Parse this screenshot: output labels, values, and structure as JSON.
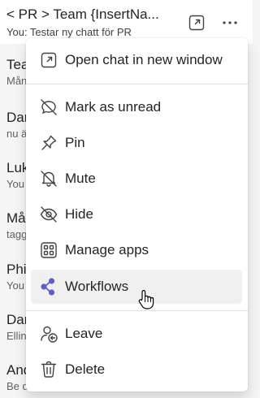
{
  "chat": {
    "title": "< PR > Team {InsertNa...",
    "subtitle": "You: Testar ny chatt för PR",
    "rows": [
      {
        "name": "Tea",
        "preview": "Mån"
      },
      {
        "name": "Dar",
        "preview": "nu ä"
      },
      {
        "name": "Luk",
        "preview": "You"
      },
      {
        "name": "Må",
        "preview": "tagg"
      },
      {
        "name": "Phi",
        "preview": "You"
      },
      {
        "name": "Dar",
        "preview": "Ellin"
      },
      {
        "name": "And",
        "preview": "Be d"
      }
    ]
  },
  "menu": {
    "open_new_window": "Open chat in new window",
    "mark_unread": "Mark as unread",
    "pin": "Pin",
    "mute": "Mute",
    "hide": "Hide",
    "manage_apps": "Manage apps",
    "workflows": "Workflows",
    "leave": "Leave",
    "delete": "Delete"
  },
  "colors": {
    "workflows_accent": "#5b5fc7",
    "hover_background": "#f0f0f0"
  }
}
